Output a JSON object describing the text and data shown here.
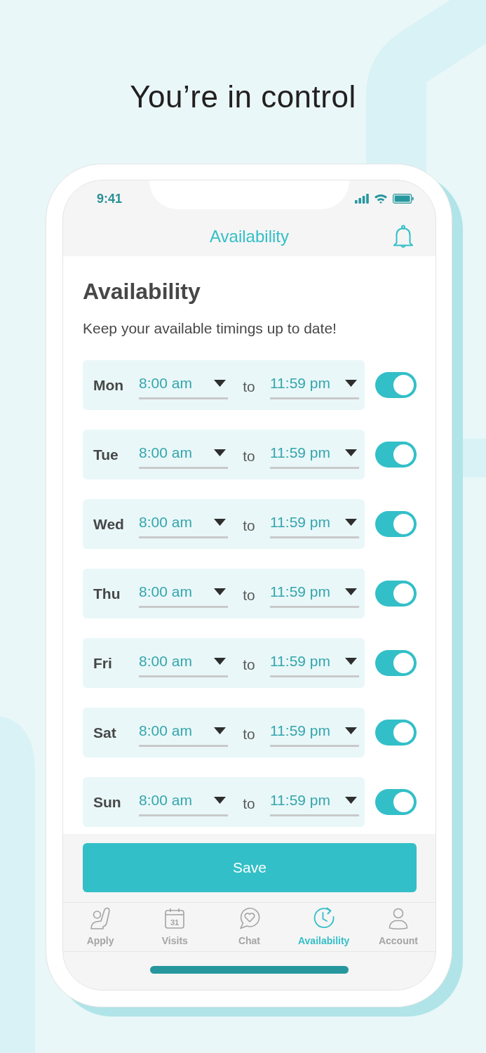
{
  "headline": "You’re in control",
  "status_bar": {
    "time": "9:41"
  },
  "nav_bar": {
    "title": "Availability"
  },
  "content": {
    "heading": "Availability",
    "subtitle": "Keep your available timings up to date!"
  },
  "days": [
    {
      "day": "Mon",
      "start": "8:00 am",
      "separator": "to",
      "end": "11:59 pm",
      "on": true
    },
    {
      "day": "Tue",
      "start": "8:00 am",
      "separator": "to",
      "end": "11:59 pm",
      "on": true
    },
    {
      "day": "Wed",
      "start": "8:00 am",
      "separator": "to",
      "end": "11:59 pm",
      "on": true
    },
    {
      "day": "Thu",
      "start": "8:00 am",
      "separator": "to",
      "end": "11:59 pm",
      "on": true
    },
    {
      "day": "Fri",
      "start": "8:00 am",
      "separator": "to",
      "end": "11:59 pm",
      "on": true
    },
    {
      "day": "Sat",
      "start": "8:00 am",
      "separator": "to",
      "end": "11:59 pm",
      "on": true
    },
    {
      "day": "Sun",
      "start": "8:00 am",
      "separator": "to",
      "end": "11:59 pm",
      "on": true
    }
  ],
  "save_button": {
    "label": "Save"
  },
  "tab_bar": [
    {
      "kind": "hand",
      "label": "Apply",
      "selected": false
    },
    {
      "kind": "calendar",
      "icon_text": "31",
      "label": "Visits",
      "selected": false
    },
    {
      "kind": "chat",
      "label": "Chat",
      "selected": false
    },
    {
      "kind": "clock",
      "label": "Availability",
      "selected": true
    },
    {
      "kind": "person",
      "label": "Account",
      "selected": false
    }
  ]
}
